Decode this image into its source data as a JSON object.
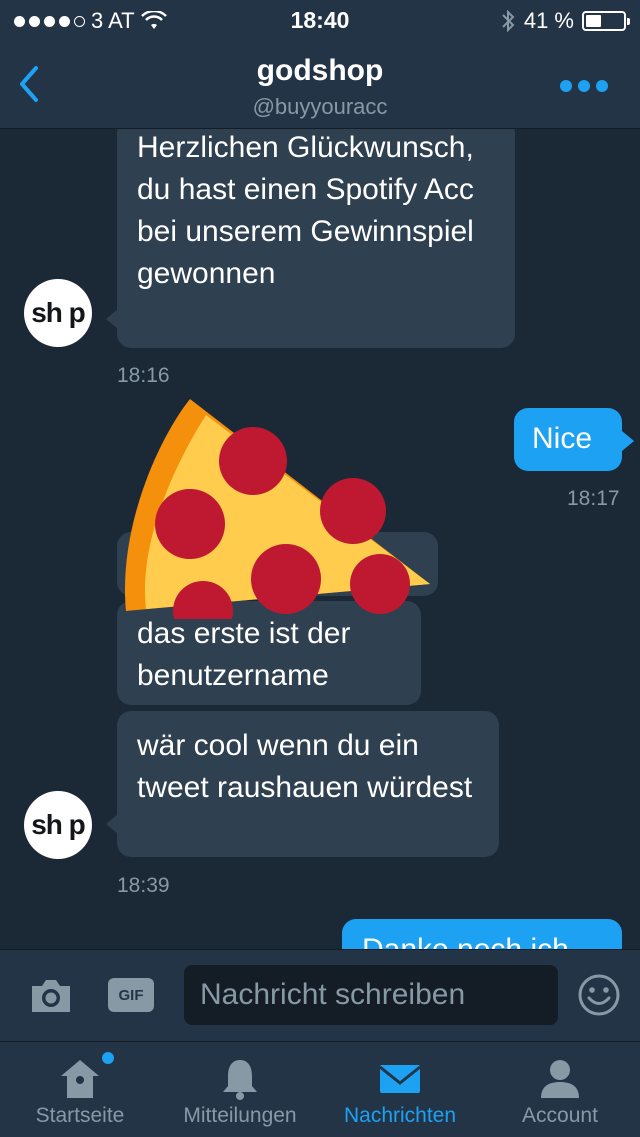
{
  "status_bar": {
    "carrier": "3 AT",
    "time": "18:40",
    "battery_percent": "41 %",
    "battery_level": 0.41
  },
  "header": {
    "title": "godshop",
    "handle": "@buyyouracc"
  },
  "messages": [
    {
      "text": "Herzlichen Glückwunsch, du hast einen Spotify Acc bei unserem Gewinnspiel gewonnen"
    },
    {
      "text": "Nice"
    },
    {
      "text": "das erste ist der benutzername"
    },
    {
      "text": "wär cool wenn du ein tweet raushauen würdest"
    },
    {
      "text": "Danke noch ich"
    }
  ],
  "timestamps": [
    "18:16",
    "18:17",
    "18:39"
  ],
  "avatar_label": "sh p",
  "composer": {
    "placeholder": "Nachricht schreiben",
    "gif_label": "GIF"
  },
  "tabs": [
    {
      "label": "Startseite",
      "icon": "home-icon"
    },
    {
      "label": "Mitteilungen",
      "icon": "bell-icon"
    },
    {
      "label": "Nachrichten",
      "icon": "envelope-icon",
      "active": true
    },
    {
      "label": "Account",
      "icon": "person-icon"
    }
  ],
  "colors": {
    "accent": "#1da1f2",
    "bg": "#1b2836",
    "bar": "#243447",
    "bubble": "#2f4050"
  }
}
